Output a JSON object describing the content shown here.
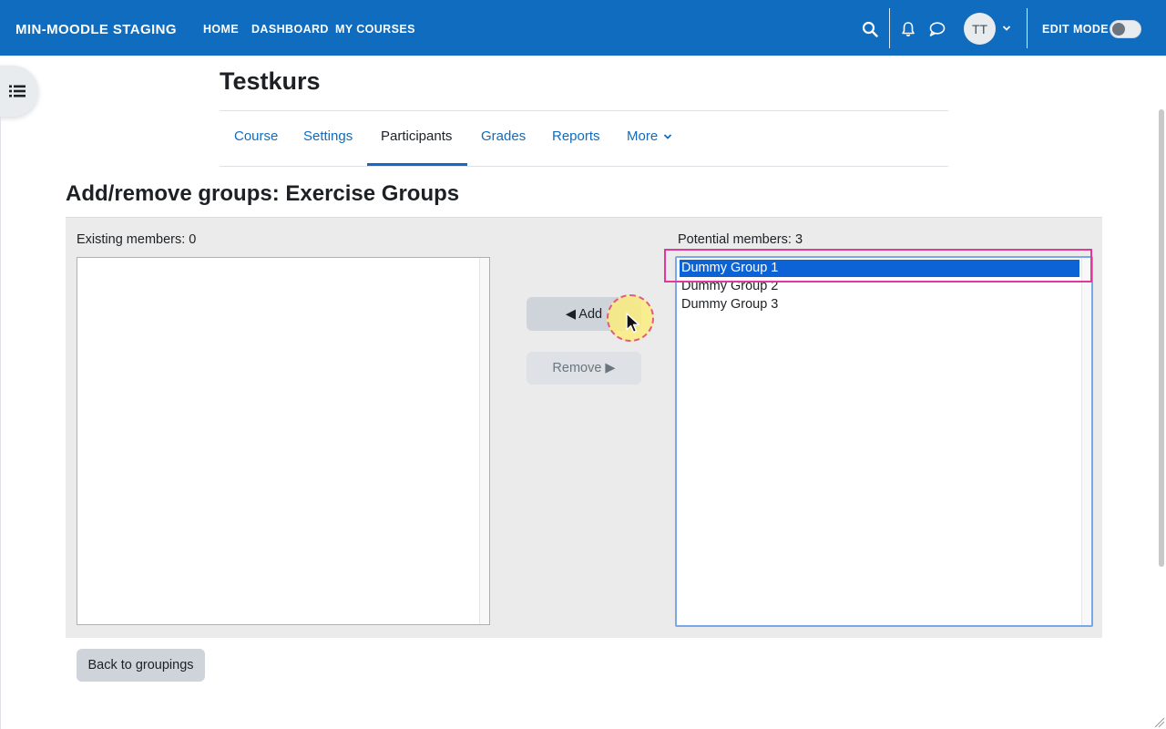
{
  "navbar": {
    "brand": "MIN-MOODLE STAGING",
    "links": [
      "HOME",
      "DASHBOARD",
      "MY COURSES"
    ],
    "avatar_initials": "TT",
    "edit_mode_label": "EDIT MODE",
    "edit_mode_on": false,
    "icons": [
      "search-icon",
      "bell-icon",
      "chat-icon",
      "chevron-down-icon"
    ]
  },
  "course": {
    "title": "Testkurs",
    "tabs": [
      {
        "label": "Course",
        "active": false
      },
      {
        "label": "Settings",
        "active": false
      },
      {
        "label": "Participants",
        "active": true
      },
      {
        "label": "Grades",
        "active": false
      },
      {
        "label": "Reports",
        "active": false
      },
      {
        "label": "More",
        "active": false
      }
    ]
  },
  "page": {
    "heading": "Add/remove groups: Exercise Groups"
  },
  "existing": {
    "label": "Existing members: 0",
    "items": []
  },
  "potential": {
    "label": "Potential members: 3",
    "items": [
      "Dummy Group 1",
      "Dummy Group 2",
      "Dummy Group 3"
    ],
    "selected_index": 0
  },
  "actions": {
    "add_label": "◀ Add",
    "remove_label": "Remove ▶"
  },
  "footer": {
    "back_label": "Back to groupings"
  },
  "colors": {
    "navbar": "#0f6cbf",
    "selection": "#0b63d6",
    "highlight": "#e0399b",
    "panel": "#ebebeb"
  }
}
